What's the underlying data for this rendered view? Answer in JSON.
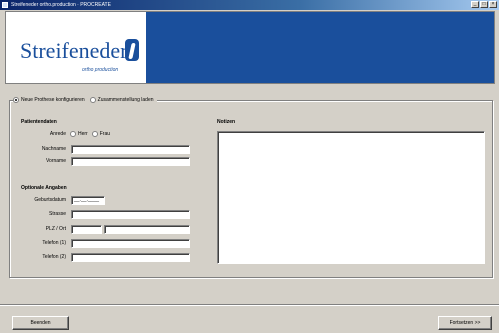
{
  "window": {
    "title": "Streifeneder ortho.production · PROCREATE",
    "minimize_glyph": "_",
    "maximize_glyph": "□",
    "close_glyph": "×"
  },
  "header": {
    "logo_text": "Streifeneder",
    "logo_subtitle": "ortho production",
    "brand_color": "#1a4f9c"
  },
  "mode": {
    "option_new": "Neue Prothese konfigurieren",
    "option_load": "Zusammenstellung laden",
    "selected": "option_new"
  },
  "patient": {
    "section_title": "Patientendaten",
    "sex_label": "Anrede",
    "sex_male": "Herr",
    "sex_female": "Frau",
    "lastname_label": "Nachname",
    "firstname_label": "Vorname"
  },
  "optional": {
    "section_title": "Optionale Angaben",
    "birthdate_label": "Geburtsdatum",
    "birthdate_value": "__.__.____",
    "street_label": "Strasse",
    "zip_city_label": "PLZ / Ort",
    "phone1_label": "Telefon (1)",
    "phone2_label": "Telefon (2)"
  },
  "notes": {
    "title": "Notizen"
  },
  "footer": {
    "exit_button": "Beenden",
    "next_button": "Fortsetzen >>"
  }
}
